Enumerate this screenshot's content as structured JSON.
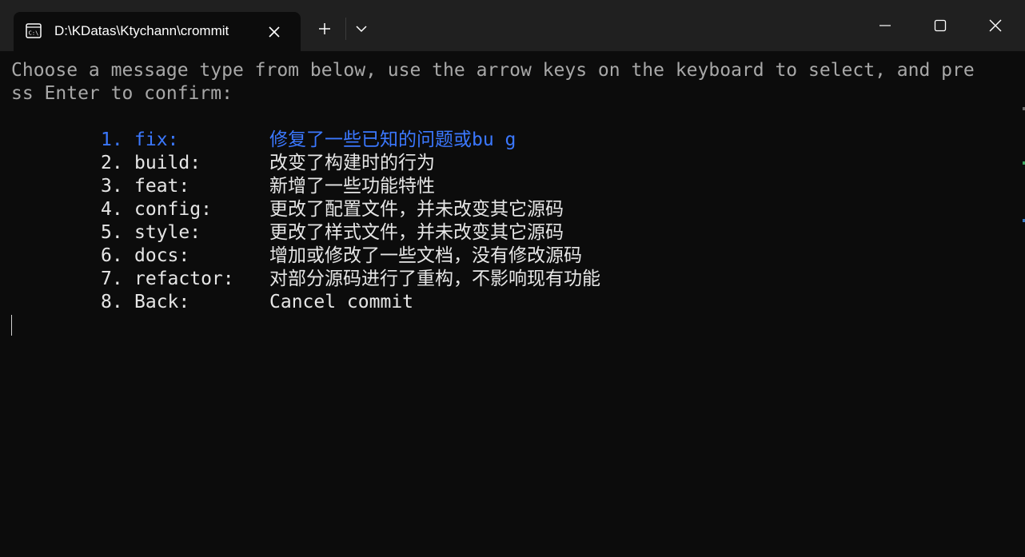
{
  "window": {
    "tab_title": "D:\\KDatas\\Ktychann\\crommit",
    "tab_icon": "terminal-icon",
    "colors": {
      "titlebar": "#202020",
      "terminal_bg": "#0c0c0c",
      "prompt_text": "#a8a8a8",
      "item_text": "#e6e6e6",
      "selected_text": "#3b78ff"
    }
  },
  "terminal": {
    "prompt_line1": "Choose a message type from below, use the arrow keys on the keyboard to select, and pre",
    "prompt_line2": "ss Enter to confirm:",
    "items": [
      {
        "number": "1.",
        "key": "fix:",
        "description": "修复了一些已知的问题或bu g",
        "selected": true
      },
      {
        "number": "2.",
        "key": "build:",
        "description": "改变了构建时的行为",
        "selected": false
      },
      {
        "number": "3.",
        "key": "feat:",
        "description": "新增了一些功能特性",
        "selected": false
      },
      {
        "number": "4.",
        "key": "config:",
        "description": "更改了配置文件，并未改变其它源码",
        "selected": false
      },
      {
        "number": "5.",
        "key": "style:",
        "description": "更改了样式文件，并未改变其它源码",
        "selected": false
      },
      {
        "number": "6.",
        "key": "docs:",
        "description": "增加或修改了一些文档，没有修改源码",
        "selected": false
      },
      {
        "number": "7.",
        "key": "refactor:",
        "description": "对部分源码进行了重构，不影响现有功能",
        "selected": false
      },
      {
        "number": "8.",
        "key": "Back:",
        "description": "Cancel commit",
        "selected": false
      }
    ]
  }
}
